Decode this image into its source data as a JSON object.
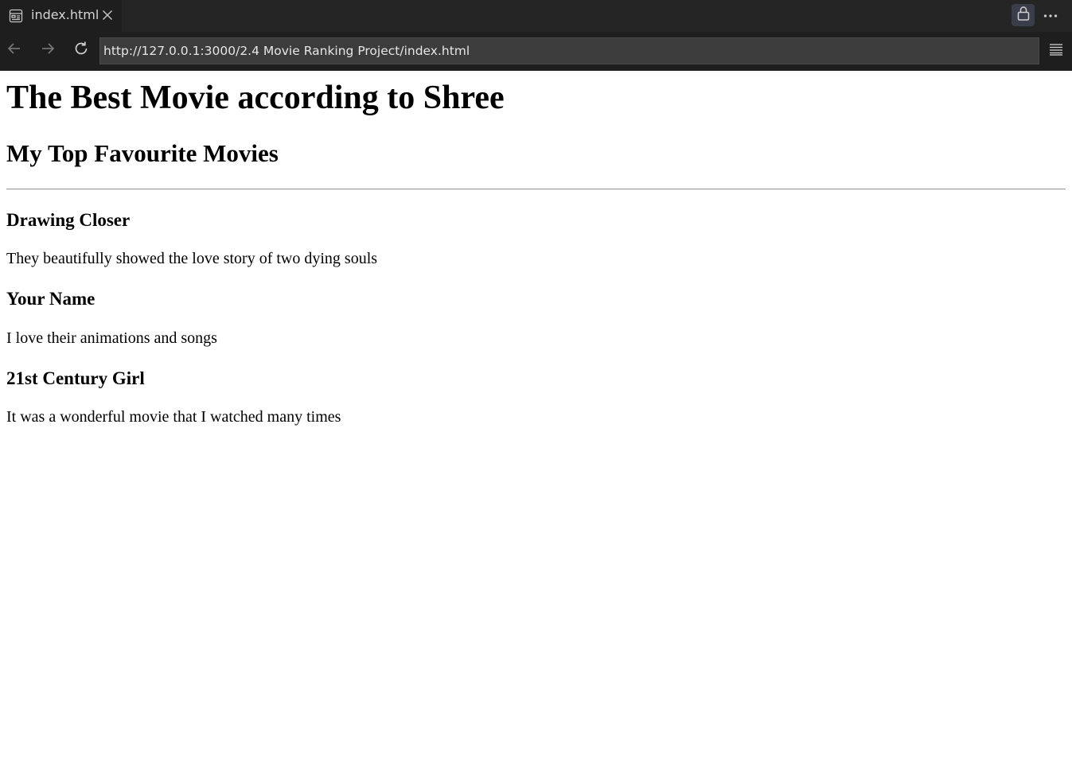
{
  "tab": {
    "label": "index.html"
  },
  "address_bar": {
    "url": "http://127.0.0.1:3000/2.4 Movie Ranking Project/index.html"
  },
  "page": {
    "title": "The Best Movie according to Shree",
    "subtitle": "My Top Favourite Movies",
    "movies": [
      {
        "name": "Drawing Closer",
        "description": "They beautifully showed the love story of two dying souls"
      },
      {
        "name": "Your Name",
        "description": "I love their animations and songs"
      },
      {
        "name": "21st Century Girl",
        "description": "It was a wonderful movie that I watched many times"
      }
    ]
  },
  "icons": {
    "tab": "preview-icon",
    "close": "close-icon",
    "lock": "lock-icon",
    "more": "more-icon",
    "back": "arrow-left-icon",
    "forward": "arrow-right-icon",
    "reload": "reload-icon",
    "menu": "menu-icon"
  },
  "colors": {
    "chrome_dark": "#1e1e1e",
    "tabbar": "#252526",
    "url_field": "#3c3c3c",
    "lock_button": "#3a3d4a",
    "page_background": "#ffffff"
  }
}
